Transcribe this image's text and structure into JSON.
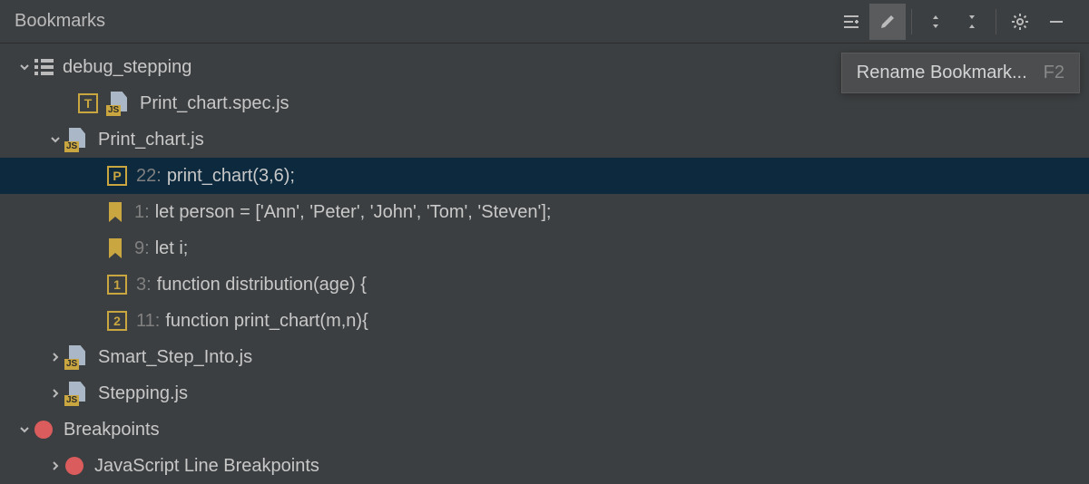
{
  "panel": {
    "title": "Bookmarks"
  },
  "toolbar": {
    "filter_icon": "filter",
    "edit_icon": "edit",
    "expand_icon": "expand",
    "collapse_icon": "collapse",
    "settings_icon": "settings",
    "minimize_icon": "minimize"
  },
  "tooltip": {
    "label": "Rename Bookmark...",
    "shortcut": "F2"
  },
  "tree": {
    "root": {
      "label": "debug_stepping"
    },
    "spec_file": {
      "mnemonic": "T",
      "name": "Print_chart.spec.js",
      "badge": "JS"
    },
    "chart_file": {
      "name": "Print_chart.js",
      "badge": "JS"
    },
    "bookmarks": [
      {
        "mnemonic": "P",
        "line": "22:",
        "code": "print_chart(3,6);"
      },
      {
        "mnemonic": "",
        "line": "1:",
        "code": "let person = ['Ann', 'Peter', 'John', 'Tom', 'Steven'];"
      },
      {
        "mnemonic": "",
        "line": "9:",
        "code": "let i;"
      },
      {
        "mnemonic": "1",
        "line": "3:",
        "code": "function distribution(age) {"
      },
      {
        "mnemonic": "2",
        "line": "11:",
        "code": "function print_chart(m,n){"
      }
    ],
    "smart_step": {
      "name": "Smart_Step_Into.js",
      "badge": "JS"
    },
    "stepping": {
      "name": "Stepping.js",
      "badge": "JS"
    },
    "breakpoints": {
      "label": "Breakpoints"
    },
    "js_breakpoints": {
      "label": "JavaScript Line Breakpoints"
    }
  }
}
